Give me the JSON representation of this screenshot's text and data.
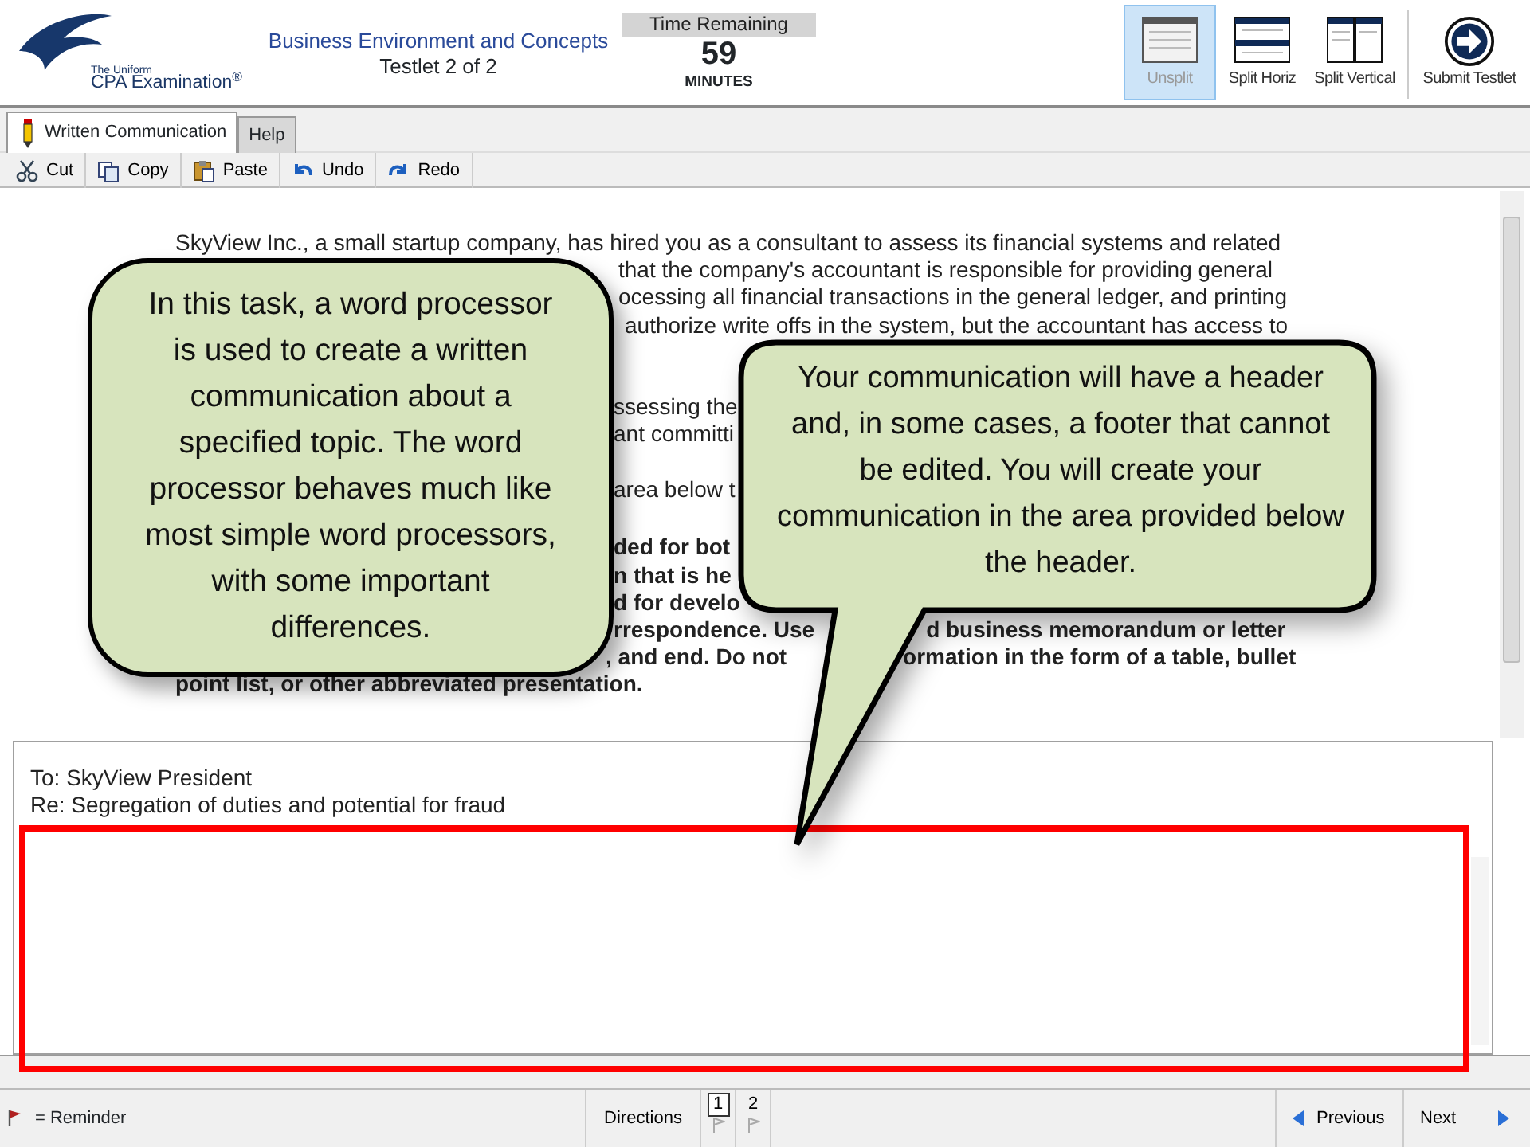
{
  "header": {
    "logo_small": "The Uniform",
    "logo": "CPA Examination$^{®}$",
    "section": "Business Environment and Concepts",
    "testlet": "Testlet 2 of 2",
    "time_label": "Time Remaining",
    "time_value": "59",
    "time_unit": "MINUTES"
  },
  "view_buttons": [
    {
      "label": "Unsplit",
      "kind": "unsplit",
      "selected": true
    },
    {
      "label": "Split Horiz",
      "kind": "horiz",
      "selected": false
    },
    {
      "label": "Split Vertical",
      "kind": "vertical",
      "selected": false
    }
  ],
  "submit_button": "Submit Testlet",
  "tabs": [
    {
      "label": "Written Communication",
      "kind": "pencil",
      "selected": true
    },
    {
      "label": "Help",
      "kind": "plain",
      "selected": false
    }
  ],
  "edit_toolbar": [
    {
      "label": "Cut",
      "kind": "cut"
    },
    {
      "label": "Copy",
      "kind": "copy"
    },
    {
      "label": "Paste",
      "kind": "paste"
    },
    {
      "label": "Undo",
      "kind": "undo"
    },
    {
      "label": "Redo",
      "kind": "redo"
    }
  ],
  "passage": [
    {
      "bold": false,
      "segments": [
        "SkyView Inc., a small startup company, has hired you as a consultant to assess its financial systems and related"
      ]
    },
    {
      "bold": false,
      "segments": [
        "that the company's accountant is responsible for providing general"
      ]
    },
    {
      "bold": false,
      "segments": [
        "ocessing all financial transactions in the general ledger, and printing"
      ]
    },
    {
      "bold": false,
      "segments": [
        "authorize write offs in the system, but the accountant has access to"
      ]
    },
    {
      "bold": false,
      "segments": [
        "ssessing the"
      ]
    },
    {
      "bold": false,
      "segments": [
        "ant committi"
      ]
    },
    {
      "bold": false,
      "segments": [
        "area below t"
      ]
    },
    {
      "bold": true,
      "segments": [
        "ded for bot"
      ]
    },
    {
      "bold": true,
      "segments": [
        "n that is he"
      ]
    },
    {
      "bold": true,
      "segments": [
        "d for develo"
      ]
    },
    {
      "bold": true,
      "segments": [
        "rrespondence. Use",
        "d business memorandum or letter"
      ]
    },
    {
      "bold": true,
      "segments": [
        ", and end. Do not",
        "ormation in the form of a table, bullet"
      ]
    },
    {
      "bold": true,
      "segments": [
        "point list, or other abbreviated presentation."
      ]
    }
  ],
  "response": {
    "header_lines": [
      "To: SkyView President",
      "Re: Segregation of duties and potential for fraud"
    ]
  },
  "callouts": [
    {
      "text": "In this task, a word processor is used to create a written communication about a specified topic. The word processor behaves much like most simple word processors, with some important differences."
    },
    {
      "text": "Your communication will have a header and, in some cases, a footer that cannot be edited. You will create your communication in the area provided below the header."
    }
  ],
  "footer": {
    "legend": "= Reminder",
    "directions": "Directions",
    "pages": [
      {
        "label": "1",
        "selected": true
      },
      {
        "label": "2",
        "selected": false
      }
    ],
    "previous": "Previous",
    "next": "Next"
  }
}
